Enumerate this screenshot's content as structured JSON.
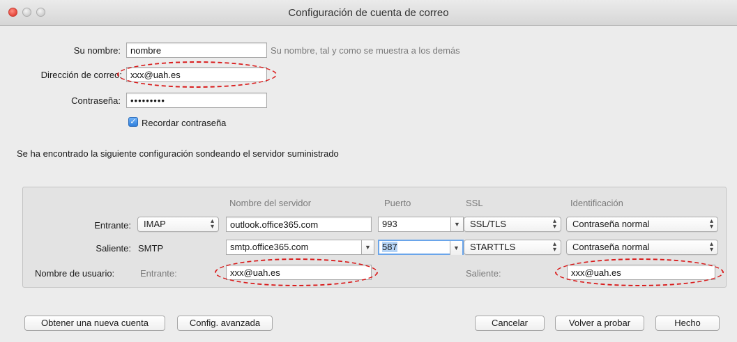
{
  "window": {
    "title": "Configuración de cuenta de correo"
  },
  "form": {
    "name_label": "Su nombre:",
    "name_value": "nombre",
    "name_hint": "Su nombre, tal y como se muestra a los demás",
    "email_label": "Dirección de correo:",
    "email_value": "xxx@uah.es",
    "password_label": "Contraseña:",
    "password_value": "•••••••••",
    "remember_label": "Recordar contraseña",
    "remember_checked": true
  },
  "status_text": "Se ha encontrado la siguiente configuración sondeando el servidor suministrado",
  "config": {
    "headers": {
      "server": "Nombre del servidor",
      "port": "Puerto",
      "ssl": "SSL",
      "auth": "Identificación"
    },
    "incoming": {
      "label": "Entrante:",
      "protocol": "IMAP",
      "server": "outlook.office365.com",
      "port": "993",
      "ssl": "SSL/TLS",
      "auth": "Contraseña normal"
    },
    "outgoing": {
      "label": "Saliente:",
      "protocol": "SMTP",
      "server": "smtp.office365.com",
      "port": "587",
      "ssl": "STARTTLS",
      "auth": "Contraseña normal"
    },
    "username": {
      "label": "Nombre de usuario:",
      "incoming_label": "Entrante:",
      "incoming_value": "xxx@uah.es",
      "outgoing_label": "Saliente:",
      "outgoing_value": "xxx@uah.es"
    }
  },
  "buttons": {
    "new_account": "Obtener una nueva cuenta",
    "advanced": "Config. avanzada",
    "cancel": "Cancelar",
    "retry": "Volver a probar",
    "done": "Hecho"
  },
  "colors": {
    "annotation": "#d91b1b",
    "focus": "#6aa5ea",
    "close_button": "#e5473c"
  },
  "icons": {
    "popup_arrows": "up-down-arrows-icon",
    "combo_arrow": "chevron-down-icon",
    "checkbox": "checkmark-icon"
  }
}
